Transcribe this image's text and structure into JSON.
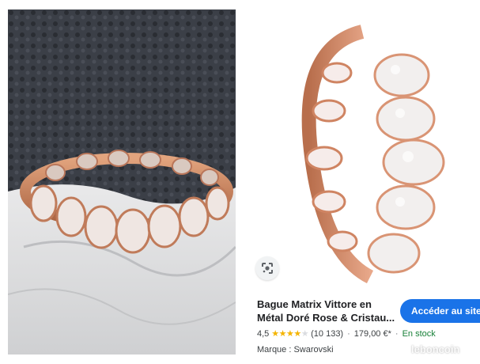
{
  "product": {
    "title_line1": "Bague Matrix Vittore en",
    "title_line2": "Métal Doré Rose & Cristau...",
    "rating": "4,5",
    "reviews": "(10 133)",
    "price": "179,00 €*",
    "availability": "En stock",
    "brand": "Marque : Swarovski"
  },
  "actions": {
    "visit_label": "Accéder au site"
  },
  "icons": {
    "lens": "google-lens-icon",
    "stars": "rating-stars-icon"
  },
  "rating_value": 4.5,
  "watermark": "leboncoin",
  "colors": {
    "accent": "#1a73e8",
    "in_stock": "#188038",
    "star": "#f4b400",
    "rose_gold": "#d4906c"
  }
}
